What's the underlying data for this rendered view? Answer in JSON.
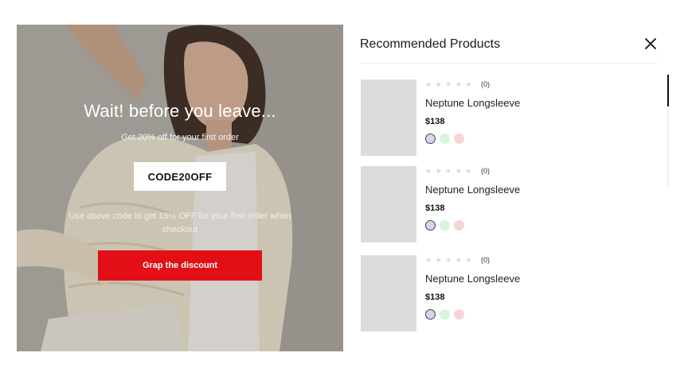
{
  "promo": {
    "title": "Wait! before you leave...",
    "subtitle": "Get 20% off for your first order",
    "coupon_code": "CODE20OFF",
    "note": "Use above code to get 15% OFF for your first order when checkout",
    "cta_label": "Grap the discount",
    "cta_color": "#e21016"
  },
  "recommendations": {
    "title": "Recommended Products",
    "close_icon": "close-icon",
    "products": [
      {
        "rating_stars": "★ ★ ★ ★ ★",
        "rating": 0,
        "review_count": "(0)",
        "name": "Neptune Longsleeve",
        "price": "$138",
        "colors": [
          "#d8d3f0",
          "#d7f5d9",
          "#f7d4d6"
        ],
        "selected_color": 0
      },
      {
        "rating_stars": "★ ★ ★ ★ ★",
        "rating": 0,
        "review_count": "(0)",
        "name": "Neptune Longsleeve",
        "price": "$138",
        "colors": [
          "#d8d3f0",
          "#d7f5d9",
          "#f7d4d6"
        ],
        "selected_color": 0
      },
      {
        "rating_stars": "★ ★ ★ ★ ★",
        "rating": 0,
        "review_count": "(0)",
        "name": "Neptune Longsleeve",
        "price": "$138",
        "colors": [
          "#d8d3f0",
          "#d7f5d9",
          "#f7d4d6"
        ],
        "selected_color": 0
      }
    ]
  }
}
